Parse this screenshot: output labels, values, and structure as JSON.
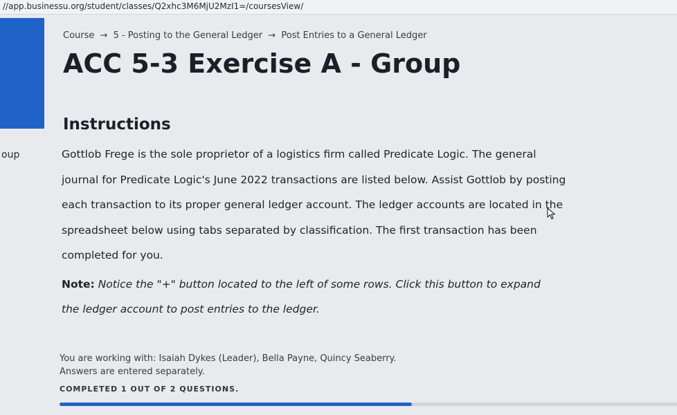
{
  "browser": {
    "url": "//app.businessu.org/student/classes/Q2xhc3M6MjU2MzI1=/coursesView/"
  },
  "sidebar": {
    "accent_color": "#1f63c6",
    "truncated_label": "oup"
  },
  "breadcrumb": {
    "items": [
      "Course",
      "5 - Posting to the General Ledger",
      "Post Entries to a General Ledger"
    ],
    "separator": "→"
  },
  "page": {
    "title": "ACC 5-3 Exercise A - Group",
    "section_heading": "Instructions",
    "instructions": "Gottlob Frege is the sole proprietor of a logistics firm called Predicate Logic. The general journal for Predicate Logic's June 2022 transactions are listed below. Assist Gottlob by posting each transaction to its proper general ledger account. The ledger accounts are located in the spreadsheet below using tabs separated by classification. The first transaction has been completed for you.",
    "note_label": "Note:",
    "note_text": "Notice the \"+\" button located to the left of some rows. Click this button to expand the ledger account to post entries to the ledger."
  },
  "group": {
    "working_with": "You are working with: Isaiah Dykes (Leader), Bella Payne, Quincy Seaberry.",
    "answers_note": "Answers are entered separately."
  },
  "progress": {
    "label": "COMPLETED 1 OUT OF 2 QUESTIONS.",
    "completed": 1,
    "total": 2,
    "fill_color": "#1f63c6"
  }
}
